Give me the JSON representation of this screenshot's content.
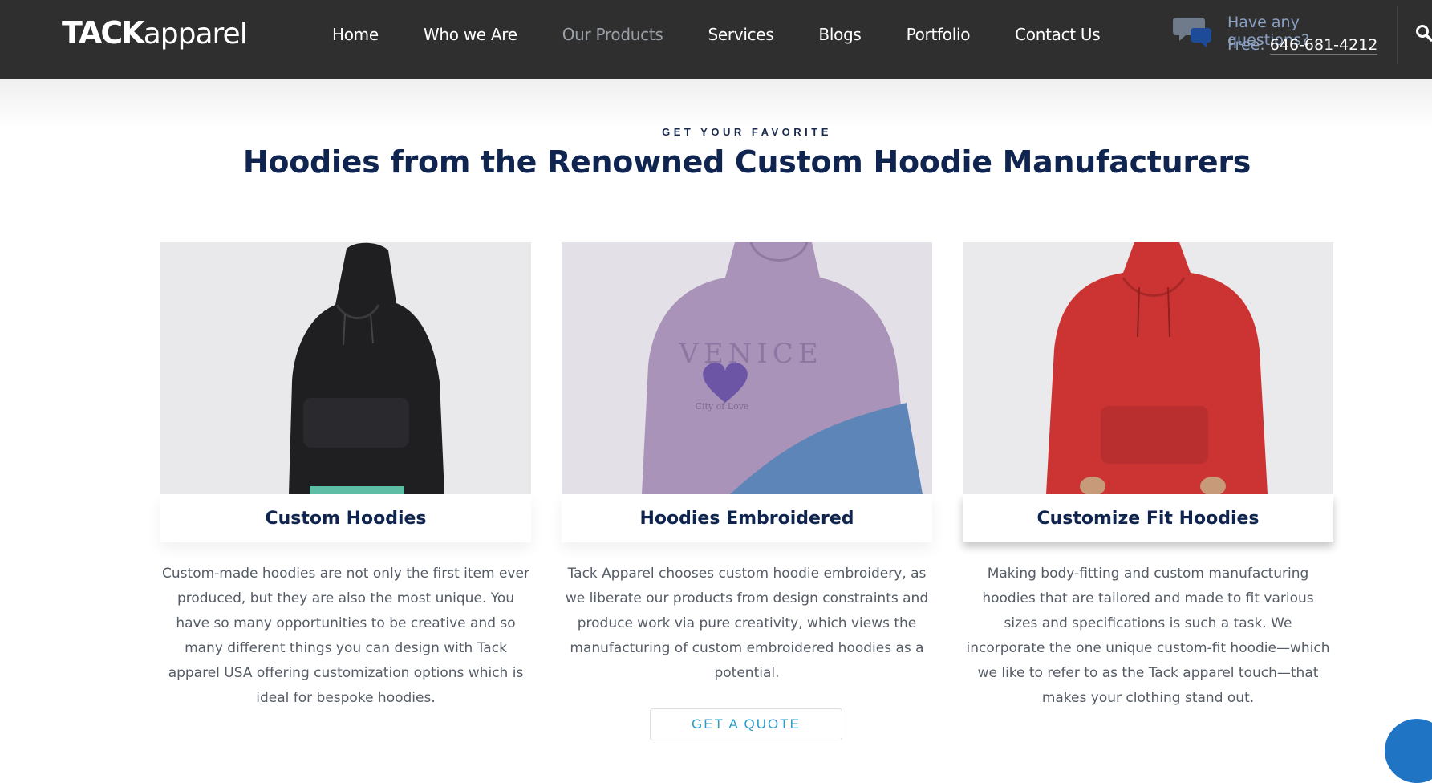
{
  "header": {
    "logo_bold": "TACK",
    "logo_light": "apparel",
    "nav": [
      {
        "label": "Home",
        "active": false
      },
      {
        "label": "Who we Are",
        "active": false
      },
      {
        "label": "Our Products",
        "active": true
      },
      {
        "label": "Services",
        "active": false
      },
      {
        "label": "Blogs",
        "active": false
      },
      {
        "label": "Portfolio",
        "active": false
      },
      {
        "label": "Contact Us",
        "active": false
      }
    ],
    "questions_text": "Have any questions?",
    "phone_prefix": "Free: ",
    "phone": "646-681-4212",
    "icons": {
      "chat": "chat-bubbles-icon",
      "search": "search-icon"
    }
  },
  "section": {
    "eyebrow": "GET YOUR FAVORITE",
    "headline": "Hoodies from the Renowned Custom Hoodie Manufacturers",
    "cards": [
      {
        "title": "Custom Hoodies",
        "description": "Custom-made hoodies are not only the first item ever produced, but they are also the most unique. You have so many opportunities to be creative and so many different things you can design with Tack apparel USA offering customization options which is ideal for bespoke hoodies.",
        "image": "black hoodie product photo",
        "hoodie_color": "#1f1f22"
      },
      {
        "title": "Hoodies Embroidered",
        "description": "Tack Apparel chooses custom hoodie embroidery, as we liberate our products from design constraints and produce work via pure creativity, which views the manufacturing of custom embroidered hoodies as a potential.",
        "image": "lavender embroidered hoodie product photo",
        "hoodie_color": "#a993b8",
        "embroidery_text": "VENICE",
        "embroidery_subtext": "City of Love"
      },
      {
        "title": "Customize Fit Hoodies",
        "description": "Making body-fitting and custom manufacturing hoodies that are tailored and made to fit various sizes and specifications is such a task. We incorporate the one unique custom-fit hoodie—which we like to refer to as the Tack apparel touch—that makes your clothing stand out.",
        "image": "red hoodie product photo",
        "hoodie_color": "#cc3434"
      }
    ],
    "quote_button": "GET A QUOTE"
  },
  "colors": {
    "header_bg": "#2f2f2f",
    "heading": "#0f2550",
    "accent_blue": "#2a9cc9",
    "chat_widget": "#1f74c4"
  }
}
